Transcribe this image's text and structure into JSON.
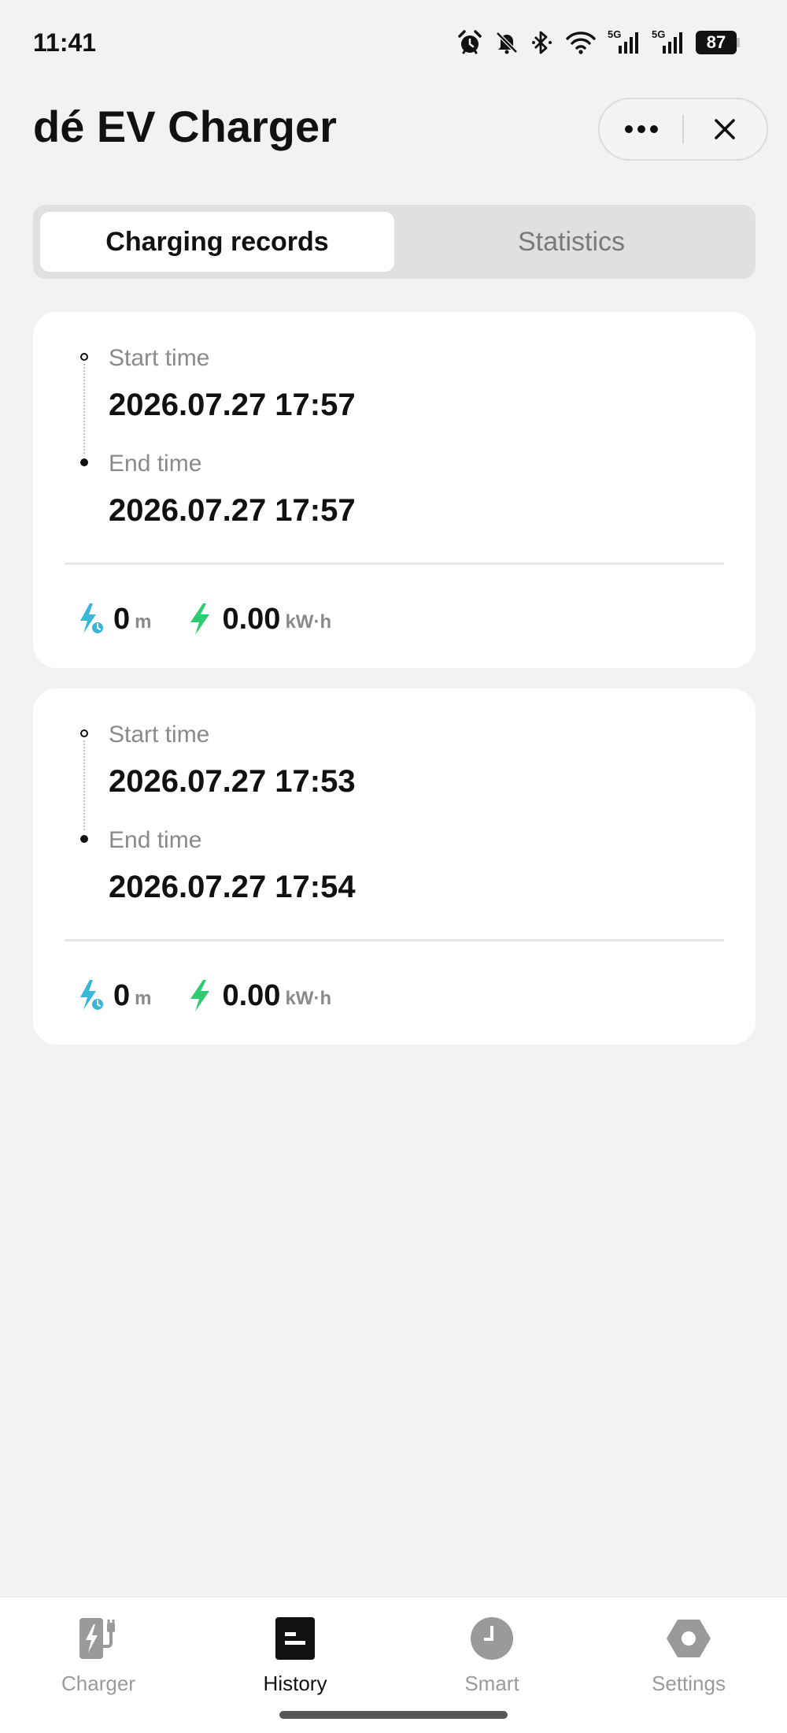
{
  "status_bar": {
    "time": "11:41",
    "battery": "87",
    "network_1": "5G",
    "network_2": "5G",
    "icons": [
      "alarm-icon",
      "mute-bell-icon",
      "bluetooth-icon",
      "wifi-icon",
      "signal-5g-icon",
      "signal-5g-icon",
      "battery-icon"
    ]
  },
  "header": {
    "title": "dé EV Charger",
    "more_icon": "more-dots-icon",
    "close_icon": "close-icon"
  },
  "tabs": [
    {
      "label": "Charging records",
      "active": true
    },
    {
      "label": "Statistics",
      "active": false
    }
  ],
  "records": [
    {
      "start_label": "Start time",
      "start": "2026.07.27 17:57",
      "end_label": "End time",
      "end": "2026.07.27 17:57",
      "duration_value": "0",
      "duration_unit": "m",
      "energy_value": "0.00",
      "energy_unit": "kW·h"
    },
    {
      "start_label": "Start time",
      "start": "2026.07.27 17:53",
      "end_label": "End time",
      "end": "2026.07.27 17:54",
      "duration_value": "0",
      "duration_unit": "m",
      "energy_value": "0.00",
      "energy_unit": "kW·h"
    }
  ],
  "nav": [
    {
      "label": "Charger",
      "icon": "charger-icon",
      "active": false
    },
    {
      "label": "History",
      "icon": "history-icon",
      "active": true
    },
    {
      "label": "Smart",
      "icon": "clock-icon",
      "active": false
    },
    {
      "label": "Settings",
      "icon": "settings-hex-icon",
      "active": false
    }
  ],
  "colors": {
    "background": "#f2f2f2",
    "duration_icon": "#3ab7d6",
    "energy_icon": "#2ecc71",
    "inactive_nav": "#9a9a9a",
    "active_nav": "#111111"
  }
}
